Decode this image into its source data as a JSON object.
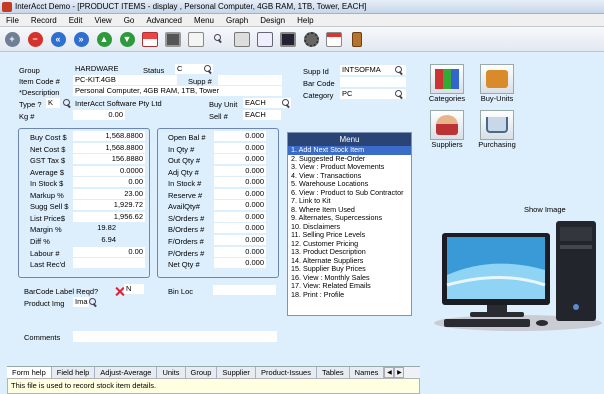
{
  "window": {
    "title": "InterAcct Demo - [PRODUCT ITEMS - display , Personal Computer, 4GB RAM, 1TB, Tower, EACH]"
  },
  "menubar": [
    "File",
    "Record",
    "Edit",
    "View",
    "Go",
    "Advanced",
    "Menu",
    "Graph",
    "Design",
    "Help"
  ],
  "header": {
    "group_label": "Group",
    "group_value": "HARDWARE",
    "status_label": "Status",
    "status_value": "C",
    "item_code_label": "Item Code #",
    "item_code_value": "PC-KIT.4GB",
    "supp_label": "Supp #",
    "supp_value": "",
    "description_label": "*Description",
    "description_value": "Personal Computer, 4GB RAM, 1TB, Tower",
    "type_label": "Type ?",
    "type_value": "K",
    "type_name": "InterAcct Software Pty Ltd",
    "buy_unit_label": "Buy Unit",
    "buy_unit_value": "EACH",
    "sell_label": "Sell #",
    "sell_value": "EACH",
    "kg_label": "Kg #",
    "kg_value": "0.00",
    "supp_id_label": "Supp Id",
    "supp_id_value": "INTSOFMA",
    "bar_code_label": "Bar Code",
    "bar_code_value": "",
    "category_label": "Category",
    "category_value": "PC"
  },
  "pricing": [
    {
      "label": "Buy Cost $",
      "value": "1,568.8800"
    },
    {
      "label": "Net Cost $",
      "value": "1,568.8800"
    },
    {
      "label": "GST Tax  $",
      "value": "156.8880"
    },
    {
      "label": "Average  $",
      "value": "0.0000"
    },
    {
      "label": "In Stock $",
      "value": "0.00"
    },
    {
      "label": "Markup %",
      "value": "23.00"
    },
    {
      "label": "Sugg Sell $",
      "value": "1,929.72"
    },
    {
      "label": "List Price$",
      "value": "1,956.62"
    },
    {
      "label": "Margin %",
      "value": "19.82"
    },
    {
      "label": "Diff %",
      "value": "6.94"
    },
    {
      "label": "Labour #",
      "value": "0.00"
    },
    {
      "label": "Last Rec'd",
      "value": ""
    }
  ],
  "quantities": [
    {
      "label": "Open Bal #",
      "value": "0.000"
    },
    {
      "label": "In  Qty #",
      "value": "0.000"
    },
    {
      "label": "Out Qty #",
      "value": "0.000"
    },
    {
      "label": "Adj Qty #",
      "value": "0.000"
    },
    {
      "label": "In Stock #",
      "value": "0.000"
    },
    {
      "label": "Reserve  #",
      "value": "0.000"
    },
    {
      "label": "AvailQty#",
      "value": "0.000"
    },
    {
      "label": "S/Orders #",
      "value": "0.000"
    },
    {
      "label": "B/Orders #",
      "value": "0.000"
    },
    {
      "label": "F/Orders #",
      "value": "0.000"
    },
    {
      "label": "P/Orders #",
      "value": "0.000"
    },
    {
      "label": "Net Qty  #",
      "value": "0.000"
    }
  ],
  "menu": {
    "title": "Menu",
    "items": [
      "1. Add Next Stock Item",
      "2. Suggested Re-Order",
      "3. View : Product Movements",
      "4. View : Transactions",
      "5. Warehouse Locations",
      "6. View : Product to Sub Contractor",
      "7. Link to Kit",
      "8. Where Item Used",
      "9. Alternates, Supercessions",
      "10. Disclaimers",
      "11. Selling Price Levels",
      "12. Customer Pricing",
      "13. Product Description",
      "14. Alternate Suppliers",
      "15. Supplier Buy Prices",
      "16. View : Monthly Sales",
      "17. View: Related Emails",
      "18. Print : Profile"
    ]
  },
  "buttons": {
    "categories": "Categories",
    "buy_units": "Buy-Units",
    "suppliers": "Suppliers",
    "purchasing": "Purchasing"
  },
  "image": {
    "label": "Show Image"
  },
  "bottom": {
    "barcode_label": "BarCode Label Reqd?",
    "barcode_value": "N",
    "bin_loc_label": "Bin Loc",
    "bin_loc_value": "",
    "product_img_label": "Product Img",
    "product_img_value": "Ima",
    "comments_label": "Comments",
    "comments_value": ""
  },
  "tabs": [
    "Form help",
    "Field help",
    "Adjust-Average",
    "Units",
    "Group",
    "Supplier",
    "Product-Issues",
    "Tables",
    "Names"
  ],
  "status_text": "This file is used to record stock item details."
}
